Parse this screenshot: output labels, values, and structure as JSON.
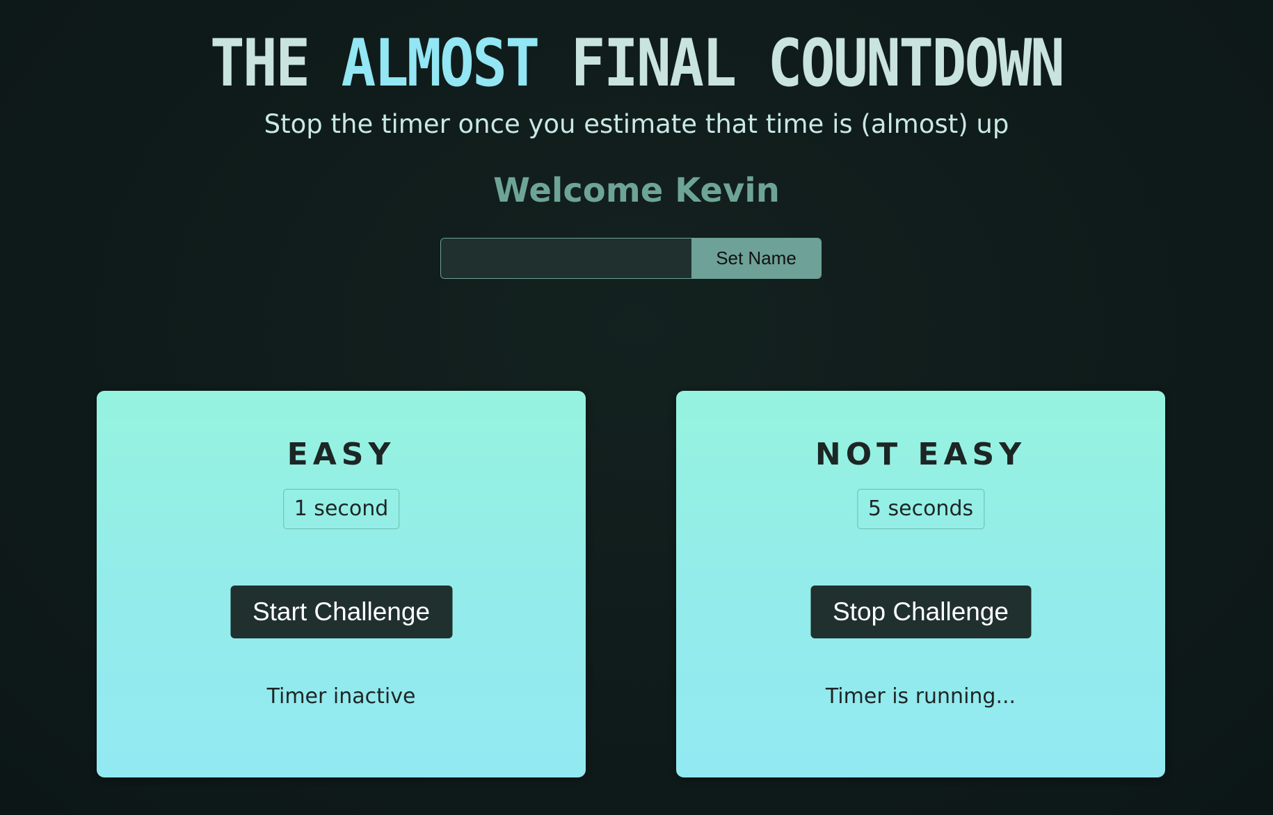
{
  "header": {
    "title_word_1": "THE",
    "title_word_2": "ALMOST",
    "title_word_3": "FINAL",
    "title_word_4": "COUNTDOWN",
    "subtitle": "Stop the timer once you estimate that time is (almost) up"
  },
  "welcome": {
    "text": "Welcome Kevin"
  },
  "name_form": {
    "input_value": "",
    "button_label": "Set Name"
  },
  "challenges": [
    {
      "title": "EASY",
      "duration": "1 second",
      "button_label": "Start Challenge",
      "status": "Timer inactive"
    },
    {
      "title": "NOT EASY",
      "duration": "5 seconds",
      "button_label": "Stop Challenge",
      "status": "Timer is running..."
    }
  ],
  "colors": {
    "background": "#0f1b1a",
    "title_plain": "#c9e3de",
    "title_accent": "#93e6f3",
    "welcome": "#6ea497",
    "card_top": "#96f3df",
    "card_bottom": "#93e9f2",
    "button_dark": "#20302e"
  }
}
